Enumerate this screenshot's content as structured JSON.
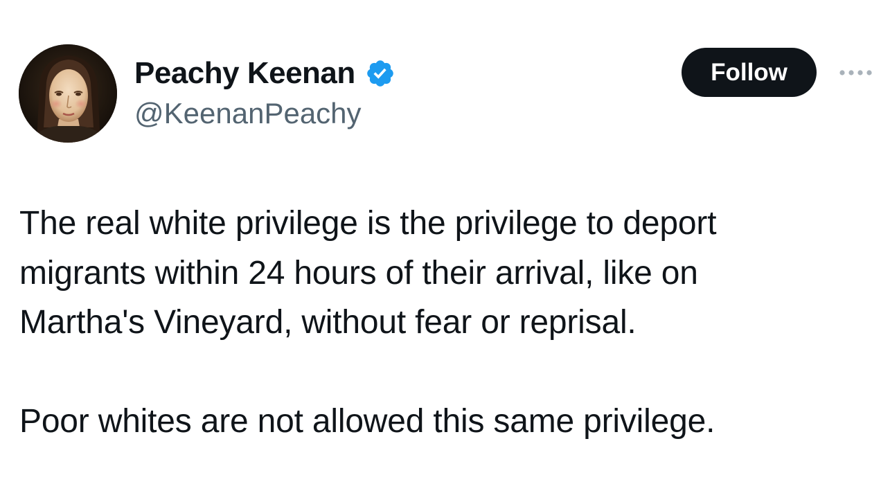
{
  "author": {
    "display_name": "Peachy Keenan",
    "handle": "@KeenanPeachy",
    "verified": true,
    "avatar_icon": "portrait-avatar",
    "verified_icon": "verified-badge-icon"
  },
  "actions": {
    "follow_label": "Follow",
    "more_icon": "more-options-icon"
  },
  "tweet": {
    "lines": [
      "The real white privilege is the privilege to deport",
      "migrants within 24 hours of their arrival, like on",
      "Martha's Vineyard, without fear or reprisal."
    ],
    "paragraph2": "Poor whites are not allowed this same privilege."
  },
  "colors": {
    "text_primary": "#0f1419",
    "text_secondary": "#536471",
    "verified_blue": "#1d9bf0",
    "follow_button_bg": "#0f1419",
    "follow_button_text": "#ffffff",
    "background": "#ffffff"
  }
}
